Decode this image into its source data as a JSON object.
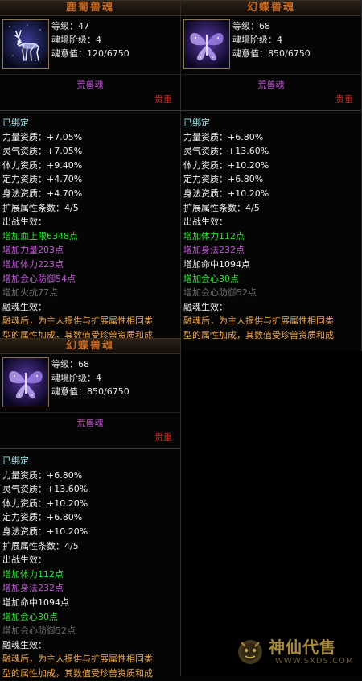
{
  "panels": [
    {
      "title": "鹿蜀兽魂",
      "level": "等级：47",
      "stage": "魂境阶级：4",
      "soul": "魂意值：120/6750",
      "kind": "荒兽魂",
      "rank": "贵重",
      "icon": "deer-spirit-icon",
      "bound": "已绑定",
      "attrs": [
        {
          "text": "力量资质：+7.05%",
          "color": "white"
        },
        {
          "text": "灵气资质：+7.05%",
          "color": "white"
        },
        {
          "text": "体力资质：+9.40%",
          "color": "white"
        },
        {
          "text": "定力资质：+4.70%",
          "color": "white"
        },
        {
          "text": "身法资质：+4.70%",
          "color": "white"
        },
        {
          "text": "扩展属性条数：4/5",
          "color": "white"
        },
        {
          "text": "出战生效：",
          "color": "white"
        },
        {
          "text": "增加血上限6348点",
          "color": "green"
        },
        {
          "text": "增加力量203点",
          "color": "purple"
        },
        {
          "text": "增加体力223点",
          "color": "purple"
        },
        {
          "text": "增加会心防御54点",
          "color": "purple"
        },
        {
          "text": "增加火抗77点",
          "color": "grey"
        },
        {
          "text": "融魂生效：",
          "color": "white"
        },
        {
          "text": "融魂后，为主人提供与扩展属性相同类",
          "color": "orange"
        },
        {
          "text": "型的属性加成，其数值受珍兽资质和成",
          "color": "orange"
        }
      ]
    },
    {
      "title": "幻蝶兽魂",
      "level": "等级：68",
      "stage": "魂境阶级：4",
      "soul": "魂意值：850/6750",
      "kind": "荒兽魂",
      "rank": "贵重",
      "icon": "butterfly-spirit-icon",
      "bound": "已绑定",
      "attrs": [
        {
          "text": "力量资质：+6.80%",
          "color": "white"
        },
        {
          "text": "灵气资质：+13.60%",
          "color": "white"
        },
        {
          "text": "体力资质：+10.20%",
          "color": "white"
        },
        {
          "text": "定力资质：+6.80%",
          "color": "white"
        },
        {
          "text": "身法资质：+10.20%",
          "color": "white"
        },
        {
          "text": "扩展属性条数：4/5",
          "color": "white"
        },
        {
          "text": "出战生效：",
          "color": "white"
        },
        {
          "text": "增加体力112点",
          "color": "green"
        },
        {
          "text": "增加身法232点",
          "color": "purple"
        },
        {
          "text": "增加命中1094点",
          "color": "white"
        },
        {
          "text": "增加会心30点",
          "color": "green"
        },
        {
          "text": "增加会心防御52点",
          "color": "grey"
        },
        {
          "text": "融魂生效：",
          "color": "white"
        },
        {
          "text": "融魂后，为主人提供与扩展属性相同类",
          "color": "orange"
        },
        {
          "text": "型的属性加成，其数值受珍兽资质和成",
          "color": "orange"
        }
      ]
    },
    {
      "title": "幻蝶兽魂",
      "level": "等级：68",
      "stage": "魂境阶级：4",
      "soul": "魂意值：850/6750",
      "kind": "荒兽魂",
      "rank": "贵重",
      "icon": "butterfly-spirit-icon",
      "bound": "已绑定",
      "attrs": [
        {
          "text": "力量资质：+6.80%",
          "color": "white"
        },
        {
          "text": "灵气资质：+13.60%",
          "color": "white"
        },
        {
          "text": "体力资质：+10.20%",
          "color": "white"
        },
        {
          "text": "定力资质：+6.80%",
          "color": "white"
        },
        {
          "text": "身法资质：+10.20%",
          "color": "white"
        },
        {
          "text": "扩展属性条数：4/5",
          "color": "white"
        },
        {
          "text": "出战生效：",
          "color": "white"
        },
        {
          "text": "增加体力112点",
          "color": "green"
        },
        {
          "text": "增加身法232点",
          "color": "purple"
        },
        {
          "text": "增加命中1094点",
          "color": "white"
        },
        {
          "text": "增加会心30点",
          "color": "green"
        },
        {
          "text": "增加会心防御52点",
          "color": "grey"
        },
        {
          "text": "融魂生效：",
          "color": "white"
        },
        {
          "text": "融魂后，为主人提供与扩展属性相同类",
          "color": "orange"
        },
        {
          "text": "型的属性加成，其数值受珍兽资质和成",
          "color": "orange"
        }
      ]
    }
  ],
  "watermark": {
    "name": "神仙代售",
    "url": "WWW.SXDS.COM",
    "logo": "sxds-mascot-logo"
  },
  "colors": {
    "title": "#c96a22",
    "kind": "#c04ad8",
    "rank": "#d0281f",
    "bound": "#9fe6f0",
    "green": "#33e23a",
    "purple": "#c15bd9",
    "grey": "#6f6f6f",
    "orange": "#f0a84a"
  }
}
